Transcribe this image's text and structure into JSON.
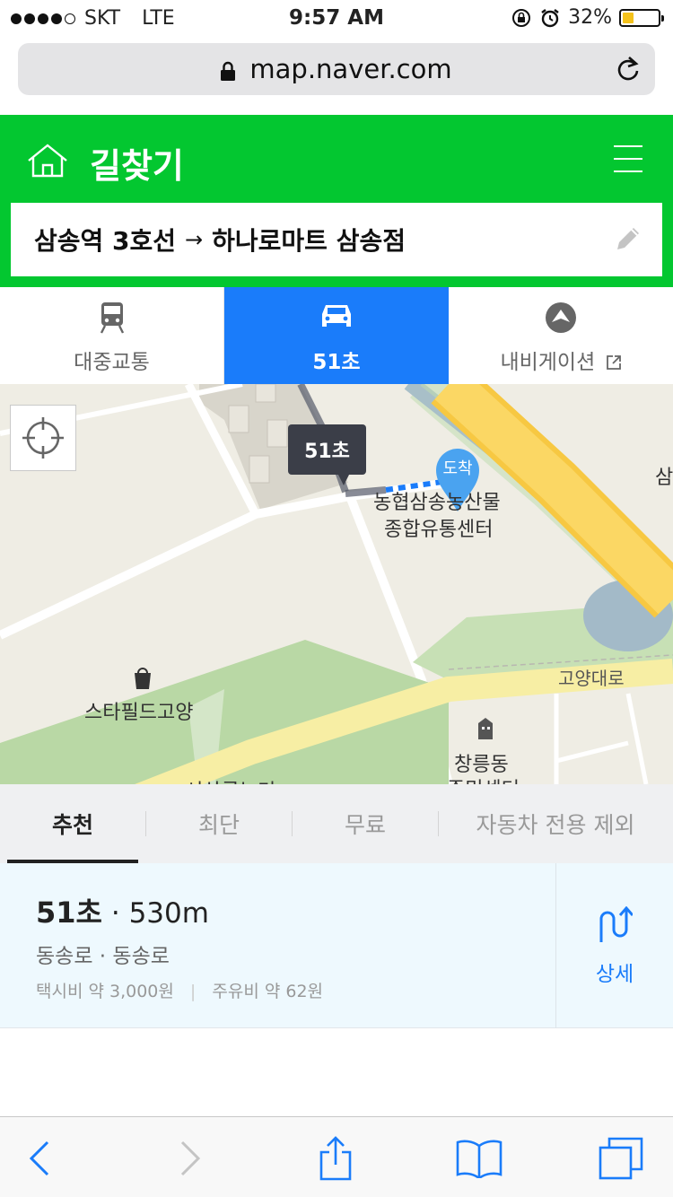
{
  "status_bar": {
    "carrier": "SKT",
    "network": "LTE",
    "time": "9:57 AM",
    "battery": "32%",
    "battery_level": 0.32
  },
  "browser": {
    "url": "map.naver.com"
  },
  "header": {
    "title": "길찾기",
    "route_from": "삼송역 3호선",
    "route_arrow": "→",
    "route_to": "하나로마트 삼송점"
  },
  "mode_tabs": [
    {
      "label": "대중교통",
      "icon": "train-icon",
      "active": false
    },
    {
      "label": "51초",
      "icon": "car-icon",
      "active": true
    },
    {
      "label": "내비게이션",
      "icon": "navigation-icon",
      "active": false
    }
  ],
  "map": {
    "tooltip": "51초",
    "destination_pin": "도착",
    "labels": {
      "center_line1": "농협삼송농산물",
      "center_line2": "종합유통센터",
      "stafield": "스타필드고양",
      "goyang_road": "고양대로",
      "changneung_line1": "창릉동",
      "changneung_line2": "주민센터",
      "edge": "삼",
      "cutoff": "서삼릉누리"
    }
  },
  "route_options": [
    {
      "label": "추천",
      "active": true
    },
    {
      "label": "최단",
      "active": false
    },
    {
      "label": "무료",
      "active": false
    },
    {
      "label": "자동차 전용 제외",
      "active": false
    }
  ],
  "result": {
    "time": "51초",
    "separator": "·",
    "distance": "530m",
    "roads": "동송로 · 동송로",
    "taxi_fare": "택시비 약 3,000원",
    "fuel_cost": "주유비 약 62원",
    "cost_separator": "|",
    "detail_label": "상세"
  },
  "colors": {
    "brand_green": "#03c730",
    "active_blue": "#1a7cfa",
    "result_bg": "#eef9fe"
  }
}
